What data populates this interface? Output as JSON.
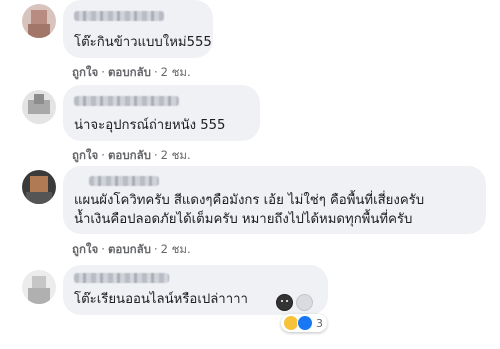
{
  "comments": [
    {
      "text": "โต๊ะกินข้าวแบบใหม่555",
      "like_label": "ถูกใจ",
      "reply_label": "ตอบกลับ",
      "time": "2 ชม."
    },
    {
      "text": "น่าจะอุปกรณ์ถ่ายหนัง 555",
      "like_label": "ถูกใจ",
      "reply_label": "ตอบกลับ",
      "time": "2 ชม."
    },
    {
      "text_line1": "แผนผังโควิทครับ สีแดงๆคือมังกร เอ้ย ไม่ใช่ๆ คือพื้นที่เสี่ยงครับ",
      "text_line2": "น้ำเงินคือปลอดภัยได้เต็มครับ หมายถึงไปได้หมดทุกพื้นที่ครับ",
      "like_label": "ถูกใจ",
      "reply_label": "ตอบกลับ",
      "time": "2 ชม."
    },
    {
      "text": "โต๊ะเรียนออนไลน์หรือเปล่าาาา",
      "reaction_count": "3"
    }
  ],
  "separator": "·",
  "icons": [
    "haha-reaction-icon",
    "like-reaction-icon",
    "emoji-icon"
  ],
  "colors": {
    "bubble": "#eff1f4",
    "meta_text": "#65676b",
    "like_blue": "#1877f2",
    "haha_yellow": "#f7c23a"
  }
}
